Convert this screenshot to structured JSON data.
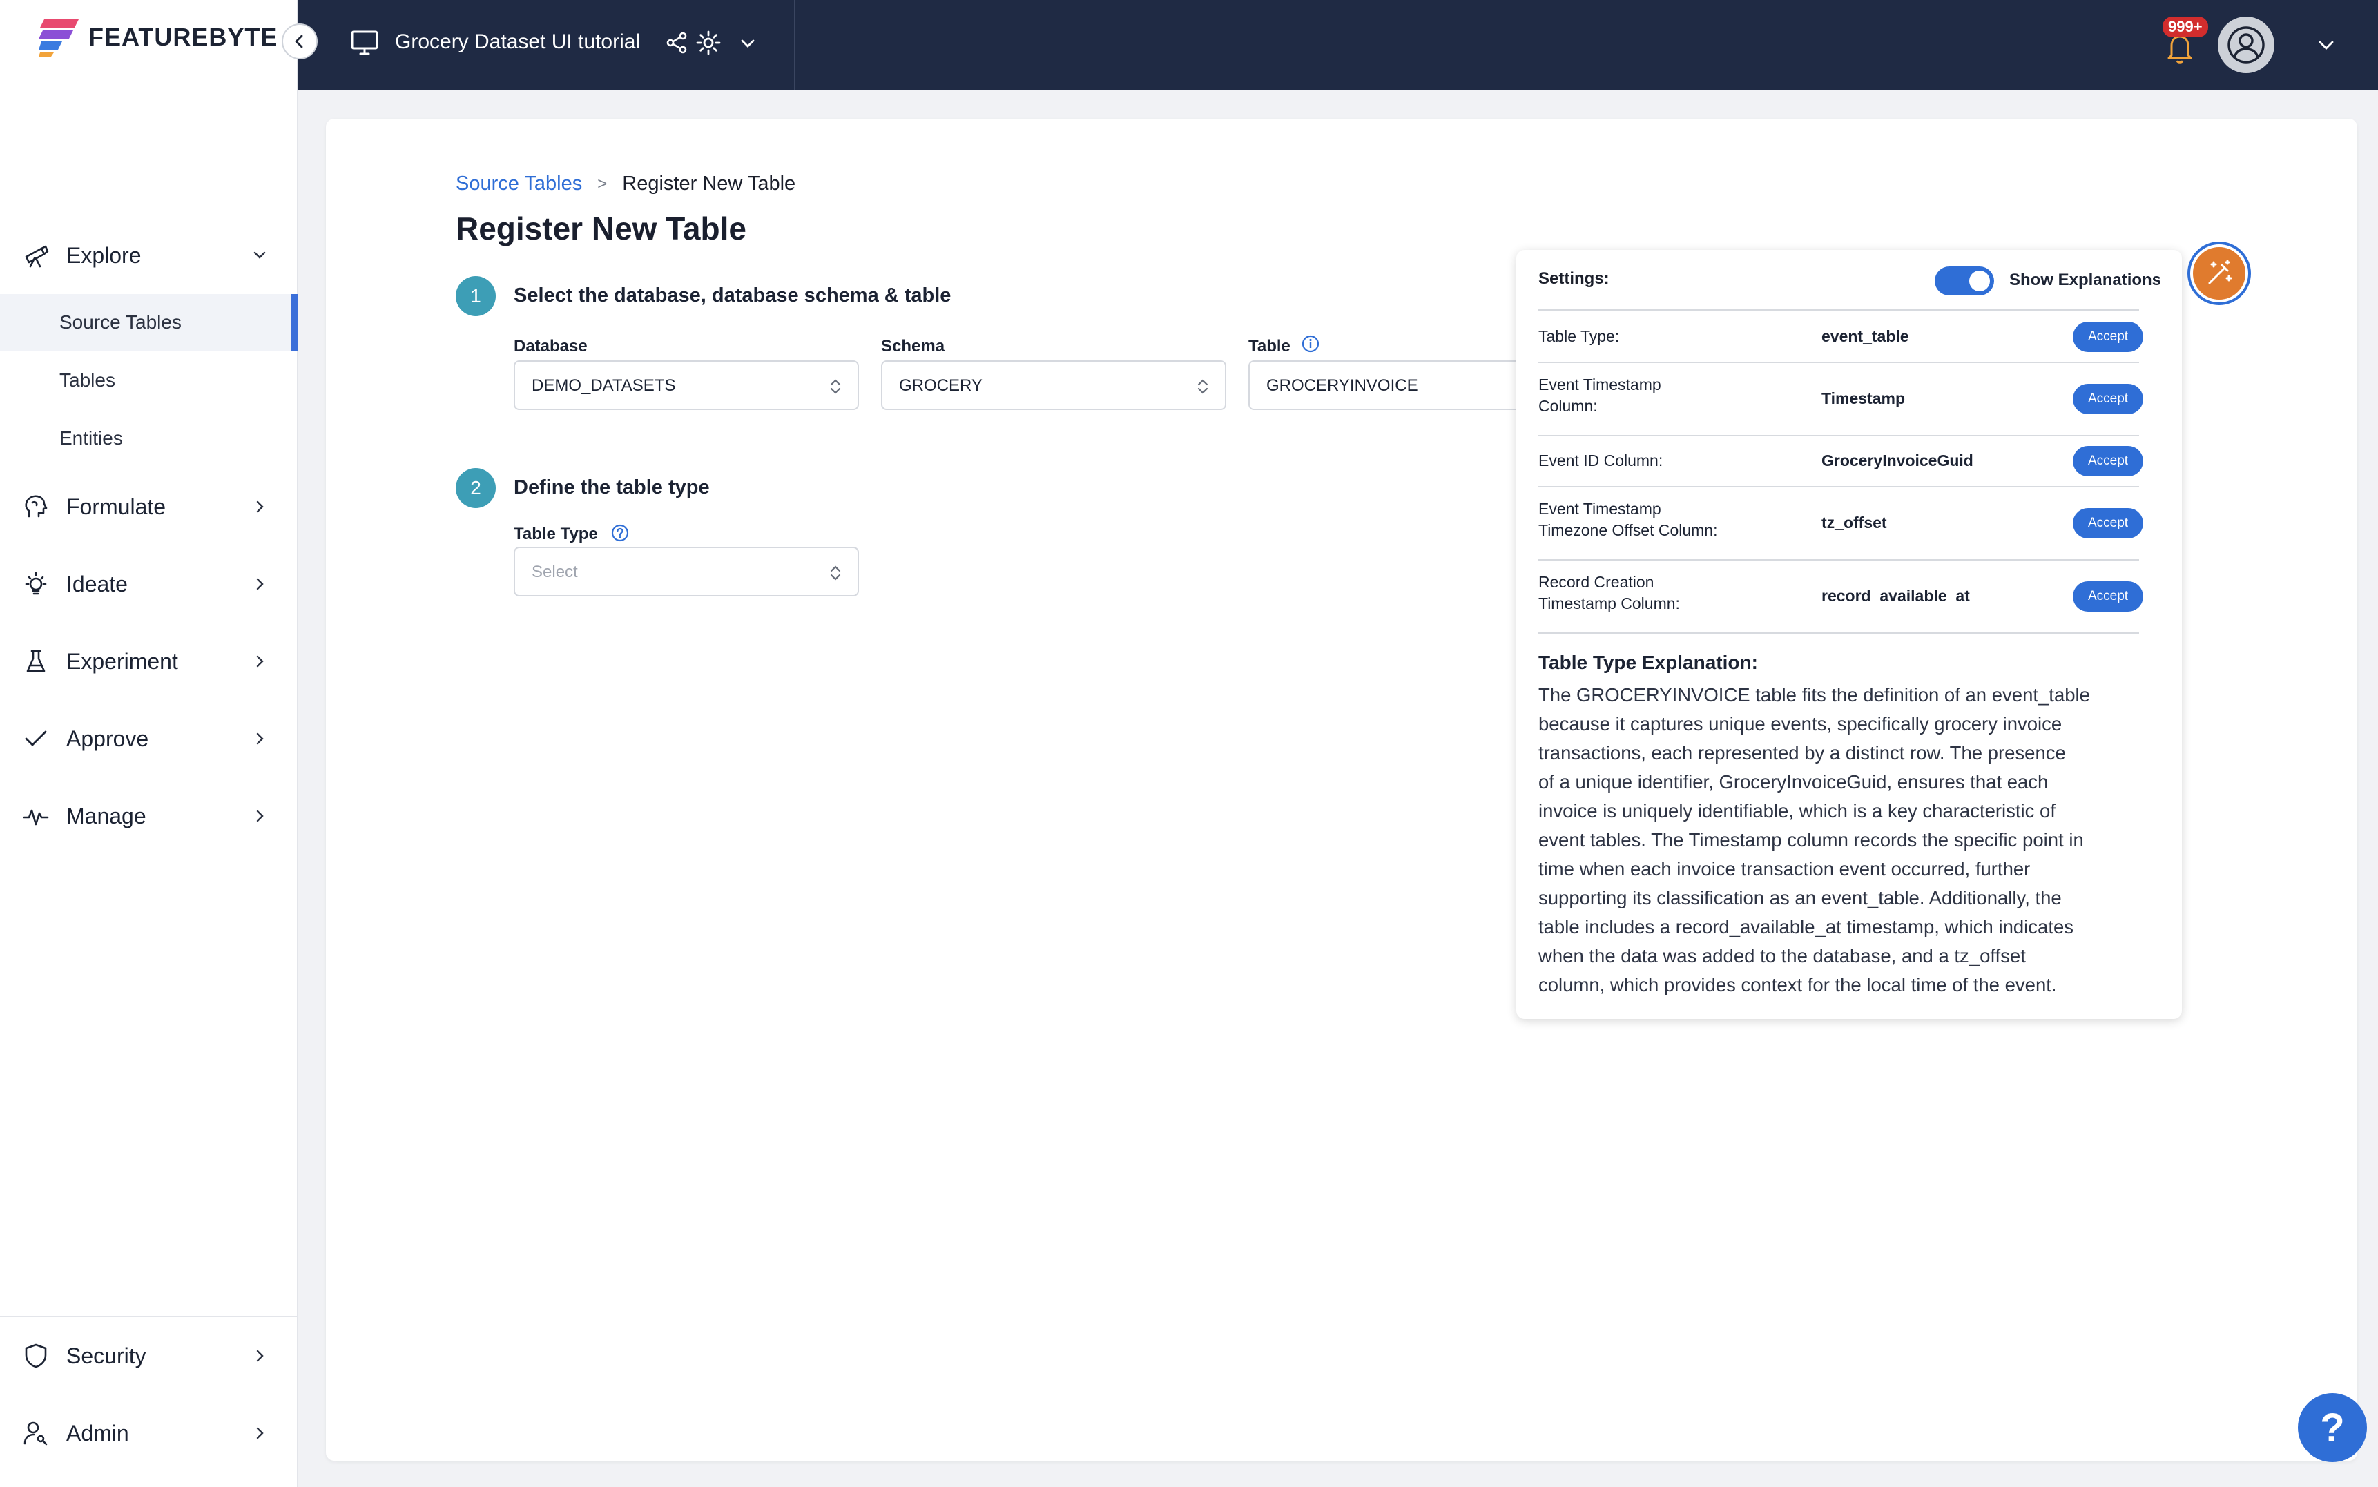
{
  "app": {
    "brand": "FEATUREBYTE"
  },
  "sidebar": {
    "explore": {
      "label": "Explore",
      "items": [
        {
          "label": "Source Tables"
        },
        {
          "label": "Tables"
        },
        {
          "label": "Entities"
        }
      ]
    },
    "sections": [
      {
        "label": "Formulate",
        "icon": "brain-icon"
      },
      {
        "label": "Ideate",
        "icon": "lightbulb-icon"
      },
      {
        "label": "Experiment",
        "icon": "flask-icon"
      },
      {
        "label": "Approve",
        "icon": "check-icon"
      },
      {
        "label": "Manage",
        "icon": "pulse-icon"
      }
    ],
    "bottom": [
      {
        "label": "Security",
        "icon": "shield-icon"
      },
      {
        "label": "Admin",
        "icon": "user-key-icon"
      }
    ]
  },
  "topbar": {
    "project_title": "Grocery Dataset UI tutorial",
    "notification_badge": "999+"
  },
  "breadcrumb": {
    "parent": "Source Tables",
    "separator": ">",
    "current": "Register New Table"
  },
  "page": {
    "title": "Register New Table"
  },
  "step1": {
    "number": "1",
    "title": "Select the database, database schema & table",
    "database": {
      "label": "Database",
      "value": "DEMO_DATASETS"
    },
    "schema": {
      "label": "Schema",
      "value": "GROCERY"
    },
    "table": {
      "label": "Table",
      "value": "GROCERYINVOICE"
    }
  },
  "step2": {
    "number": "2",
    "title": "Define the table type",
    "table_type": {
      "label": "Table Type",
      "placeholder": "Select"
    }
  },
  "settings": {
    "label": "Settings:",
    "toggle_label": "Show Explanations",
    "toggle_on": true,
    "accept_label": "Accept",
    "rows": [
      {
        "key": "Table Type:",
        "value": "event_table"
      },
      {
        "key": "Event Timestamp\nColumn:",
        "value": "Timestamp"
      },
      {
        "key": "Event ID Column:",
        "value": "GroceryInvoiceGuid"
      },
      {
        "key": "Event Timestamp\nTimezone Offset Column:",
        "value": "tz_offset"
      },
      {
        "key": "Record Creation\nTimestamp Column:",
        "value": "record_available_at"
      }
    ],
    "explanation_title": "Table Type Explanation:",
    "explanation_lines": [
      "The GROCERYINVOICE table fits the definition of an event_table",
      "because it captures unique events, specifically grocery invoice",
      "transactions, each represented by a distinct row. The presence",
      "of a unique identifier, GroceryInvoiceGuid, ensures that each",
      "invoice is uniquely identifiable, which is a key characteristic of",
      "event tables. The Timestamp column records the specific point in",
      "time when each invoice transaction event occurred, further",
      "supporting its classification as an event_table. Additionally, the",
      "table includes a record_available_at timestamp, which indicates",
      "when the data was added to the database, and a tz_offset",
      "column, which provides context for the local time of the event."
    ]
  },
  "help": {
    "label": "?"
  },
  "colors": {
    "accent": "#2f6ed6",
    "topbar": "#1f2a44",
    "step": "#3d9eb6",
    "ai_button": "#e07b2e"
  }
}
